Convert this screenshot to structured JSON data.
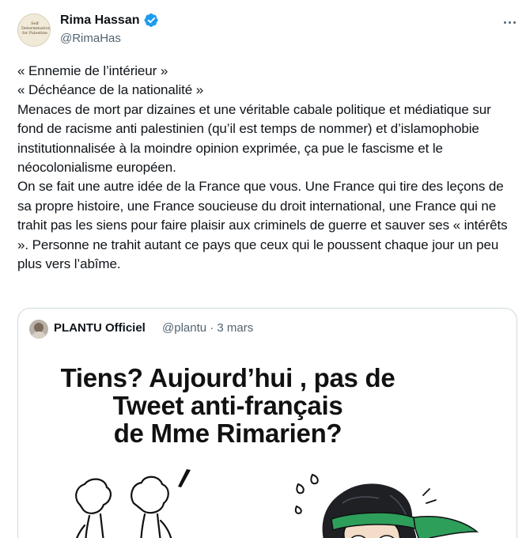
{
  "author": {
    "name": "Rima Hassan",
    "handle": "@RimaHas",
    "avatar_text": "Self Determination for Palestine",
    "verified": true
  },
  "tweet": {
    "lines": [
      "« Ennemie de l’intérieur »",
      "« Déchéance de la nationalité »",
      "Menaces de mort par dizaines et une véritable cabale politique et médiatique sur fond de racisme anti palestinien (qu’il est temps de nommer) et d’islamophobie institutionnalisée à la moindre opinion exprimée, ça pue le fascisme et le néocolonialisme européen.",
      "On se fait une autre idée de la France que vous. Une France qui tire des leçons de sa propre histoire, une France soucieuse du droit international, une France qui ne trahit pas les siens pour faire plaisir aux criminels de guerre et sauver ses « intérêts ». Personne ne trahit autant ce pays que ceux qui le poussent chaque jour un peu plus vers l’abîme."
    ]
  },
  "quote": {
    "name": "PLANTU Officiel",
    "meta": "@plantu · 3 mars",
    "cartoon_caption": "Tiens? Aujourd’hui , pas de\nTweet anti-français\nde Mme Rimarien?"
  },
  "colors": {
    "verified_blue": "#1d9bf0",
    "secondary_text": "#536471",
    "border": "#cfd9de",
    "headband_green": "#2e9e5b"
  },
  "icons": {
    "verified": "verified-badge-icon",
    "more": "more-options-icon"
  }
}
